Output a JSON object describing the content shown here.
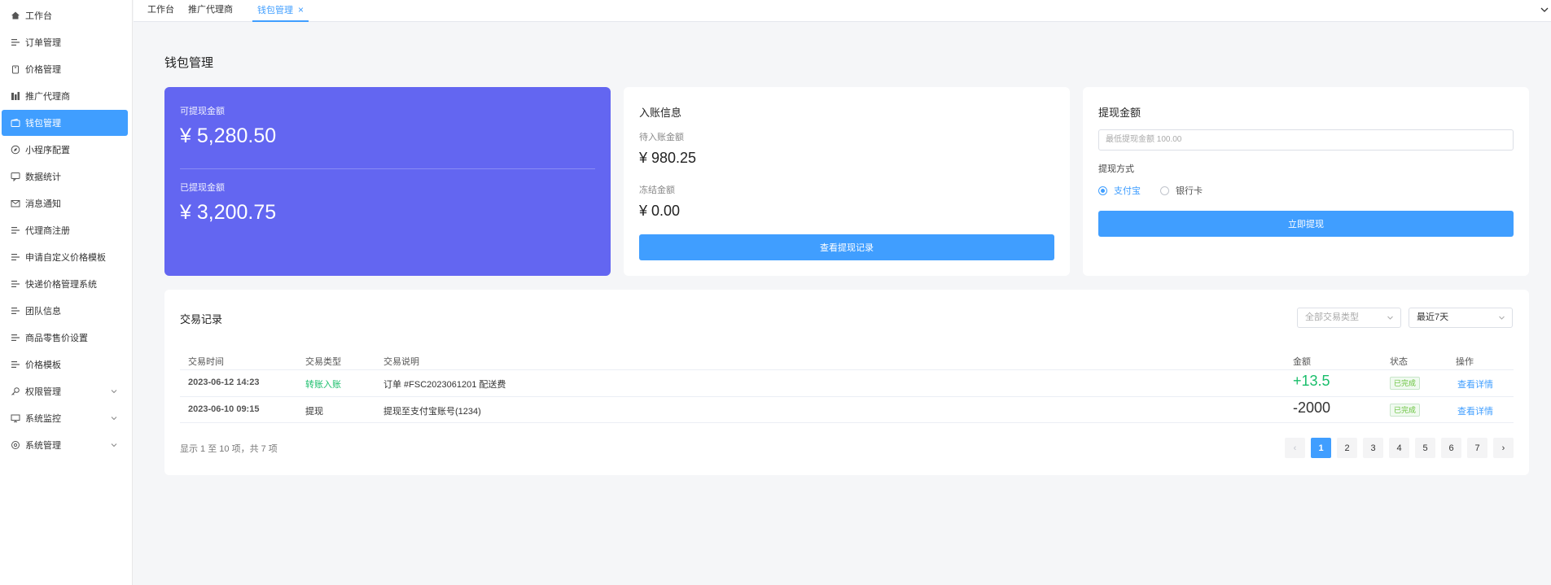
{
  "sidebar": {
    "items": [
      {
        "label": "工作台",
        "icon": "home-icon"
      },
      {
        "label": "订单管理",
        "icon": "list-icon"
      },
      {
        "label": "价格管理",
        "icon": "price-tag-icon"
      },
      {
        "label": "推广代理商",
        "icon": "building-icon"
      },
      {
        "label": "钱包管理",
        "icon": "wallet-icon",
        "active": true
      },
      {
        "label": "小程序配置",
        "icon": "compass-icon"
      },
      {
        "label": "数据统计",
        "icon": "chat-chart-icon"
      },
      {
        "label": "消息通知",
        "icon": "mail-icon"
      },
      {
        "label": "代理商注册",
        "icon": "list-icon"
      },
      {
        "label": "申请自定义价格模板",
        "icon": "list-icon"
      },
      {
        "label": "快递价格管理系统",
        "icon": "list-icon"
      },
      {
        "label": "团队信息",
        "icon": "list-icon"
      },
      {
        "label": "商品零售价设置",
        "icon": "list-icon"
      },
      {
        "label": "价格模板",
        "icon": "list-icon"
      },
      {
        "label": "权限管理",
        "icon": "key-icon",
        "expandable": true
      },
      {
        "label": "系统监控",
        "icon": "monitor-icon",
        "expandable": true
      },
      {
        "label": "系统管理",
        "icon": "settings-icon",
        "expandable": true
      }
    ]
  },
  "tabs": [
    {
      "label": "工作台"
    },
    {
      "label": "推广代理商"
    },
    {
      "label": "钱包管理",
      "active": true,
      "close": "×"
    }
  ],
  "page": {
    "title": "钱包管理"
  },
  "balance": {
    "available_label": "可提现金额",
    "available_value": "¥ 5,280.50",
    "withdrawn_label": "已提现金额",
    "withdrawn_value": "¥ 3,200.75"
  },
  "income": {
    "title": "入账信息",
    "pending_label": "待入账金额",
    "pending_value": "¥ 980.25",
    "frozen_label": "冻结金额",
    "frozen_value": "¥ 0.00",
    "records_button": "查看提现记录"
  },
  "withdraw": {
    "title": "提现金额",
    "amount_placeholder": "最低提现金额 100.00",
    "method_label": "提现方式",
    "methods": [
      {
        "label": "支付宝",
        "checked": true
      },
      {
        "label": "银行卡",
        "checked": false
      }
    ],
    "submit_button": "立即提现"
  },
  "transactions": {
    "title": "交易记录",
    "filter_type": "全部交易类型",
    "filter_range": "最近7天",
    "columns": [
      "交易时间",
      "交易类型",
      "交易说明",
      "金额",
      "状态",
      "操作"
    ],
    "rows": [
      {
        "time": "2023-06-12 14:23",
        "type": "转账入账",
        "desc": "订单 #FSC2023061201 配送费",
        "amount": "+13.5",
        "status": "已完成",
        "action": "查看详情"
      },
      {
        "time": "2023-06-10 09:15",
        "type": "提现",
        "desc": "提现至支付宝账号(1234)",
        "amount": "-2000",
        "status": "已完成",
        "action": "查看详情"
      }
    ],
    "summary": "显示 1 至 10 项，共 7 项",
    "pages": [
      "1",
      "2",
      "3",
      "4",
      "5",
      "6",
      "7"
    ],
    "current_page": 1,
    "prev": "‹",
    "next": "›"
  },
  "colors": {
    "primary": "#409eff",
    "balance_card": "#6366f1",
    "success": "#19be6b"
  }
}
